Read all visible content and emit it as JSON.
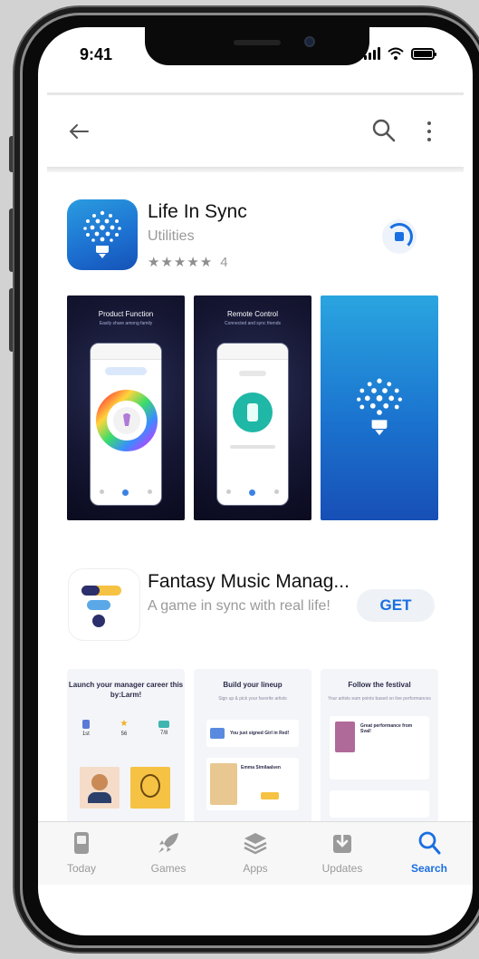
{
  "status_bar": {
    "time": "9:41"
  },
  "app1": {
    "title": "Life In Sync",
    "category": "Utilities",
    "stars": "★★★★★",
    "rating_count": "4",
    "screenshots": [
      {
        "caption": "Product Function",
        "sub": "Easily share among family"
      },
      {
        "caption": "Remote Control",
        "sub": "Connected and sync friends"
      }
    ]
  },
  "app2": {
    "title": "Fantasy Music Manag...",
    "subtitle": "A game in sync with real life!",
    "get_label": "GET",
    "promos": [
      {
        "title": "Launch your manager career this by:Larm!",
        "desc": ""
      },
      {
        "title": "Build your lineup",
        "desc": "Sign up & pick your favorite artists"
      },
      {
        "title": "Follow the festival",
        "desc": "Your artists earn points based on live performances"
      }
    ],
    "promo_details": {
      "stat1": "1st",
      "stat2": "56",
      "stat3": "7/8",
      "card2_a": "You just signed Girl in Red!",
      "card2_b": "Emma Similaalsen",
      "card3_a": "Great performance from Sval!"
    }
  },
  "tabs": [
    {
      "label": "Today",
      "icon": "today-icon"
    },
    {
      "label": "Games",
      "icon": "rocket-icon"
    },
    {
      "label": "Apps",
      "icon": "layers-icon"
    },
    {
      "label": "Updates",
      "icon": "download-tray-icon"
    },
    {
      "label": "Search",
      "icon": "search-icon"
    }
  ],
  "colors": {
    "accent": "#1a6fe0",
    "app1_icon": "#1c6fd0",
    "app2_yellow": "#f6c243",
    "app2_navy": "#2b2f6b",
    "app2_blue": "#5aa8e8"
  }
}
